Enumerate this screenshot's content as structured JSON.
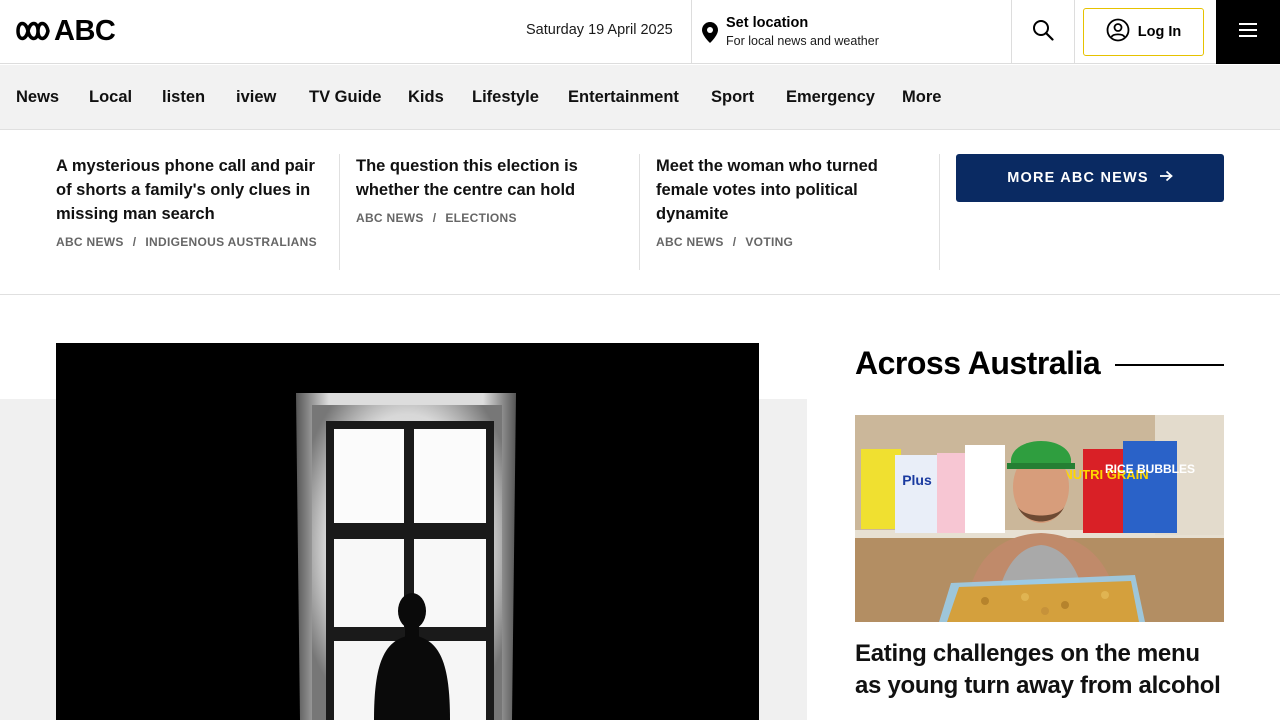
{
  "header": {
    "brand": "ABC",
    "date": "Saturday 19 April 2025",
    "location_title": "Set location",
    "location_subtitle": "For local news and weather",
    "login_label": "Log In"
  },
  "nav": {
    "items": [
      "News",
      "Local",
      "listen",
      "iview",
      "TV Guide",
      "Kids",
      "Lifestyle",
      "Entertainment",
      "Sport",
      "Emergency",
      "More"
    ]
  },
  "stories": [
    {
      "title": "A mysterious phone call and pair of shorts a family's only clues in missing man search",
      "source": "ABC NEWS",
      "topic": "INDIGENOUS AUSTRALIANS"
    },
    {
      "title": "The question this election is whether the centre can hold",
      "source": "ABC NEWS",
      "topic": "ELECTIONS"
    },
    {
      "title": "Meet the woman who turned female votes into political dynamite",
      "source": "ABC NEWS",
      "topic": "VOTING"
    }
  ],
  "more_news_label": "MORE ABC NEWS",
  "across": {
    "title": "Across Australia",
    "headline": "Eating challenges on the menu as young turn away from alcohol",
    "image_labels": [
      "NUTRI GRAIN",
      "RICE BUBBLES",
      "Plus"
    ]
  },
  "colors": {
    "more_button": "#0a2a62",
    "login_border": "#e6c200",
    "nav_bg": "#f2f2f2"
  }
}
